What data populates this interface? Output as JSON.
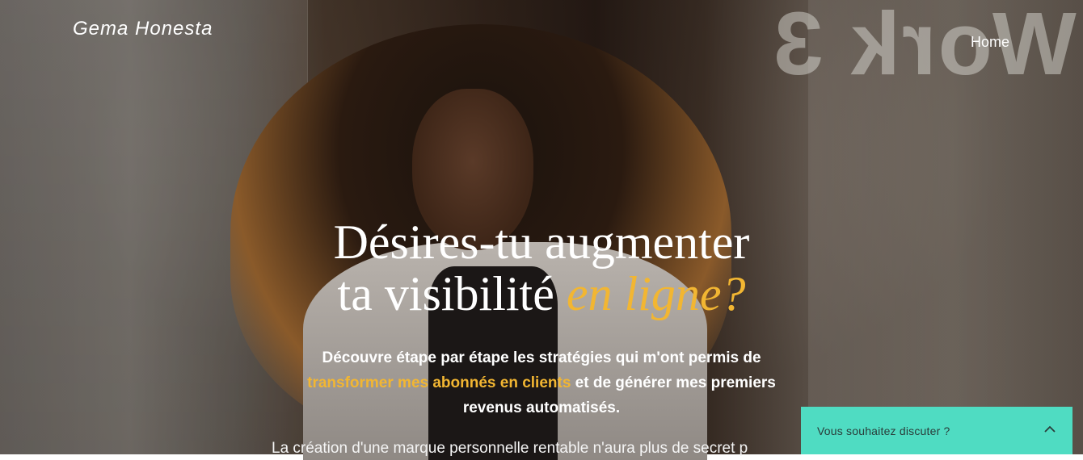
{
  "site": {
    "brand": "Gema Honesta"
  },
  "nav": {
    "items": [
      {
        "label": "Home"
      }
    ]
  },
  "hero": {
    "headline_line1": "Désires-tu augmenter",
    "headline_line2_plain": "ta visibilité ",
    "headline_line2_accent": "en ligne?",
    "sub_part1": "Découvre étape par étape les stratégies qui m'ont permis de ",
    "sub_accent": "transformer mes abonnés en clients",
    "sub_part2": " et de générer mes premiers revenus automatisés.",
    "cut_text": "La création d'une marque personnelle rentable n'aura plus de secret p"
  },
  "background": {
    "door_text": "Work 3"
  },
  "chat": {
    "label": "Vous souhaitez discuter ?",
    "icon": "chevron-up-icon"
  },
  "colors": {
    "accent": "#f2b632",
    "chat_bg": "#4fdcc2"
  }
}
